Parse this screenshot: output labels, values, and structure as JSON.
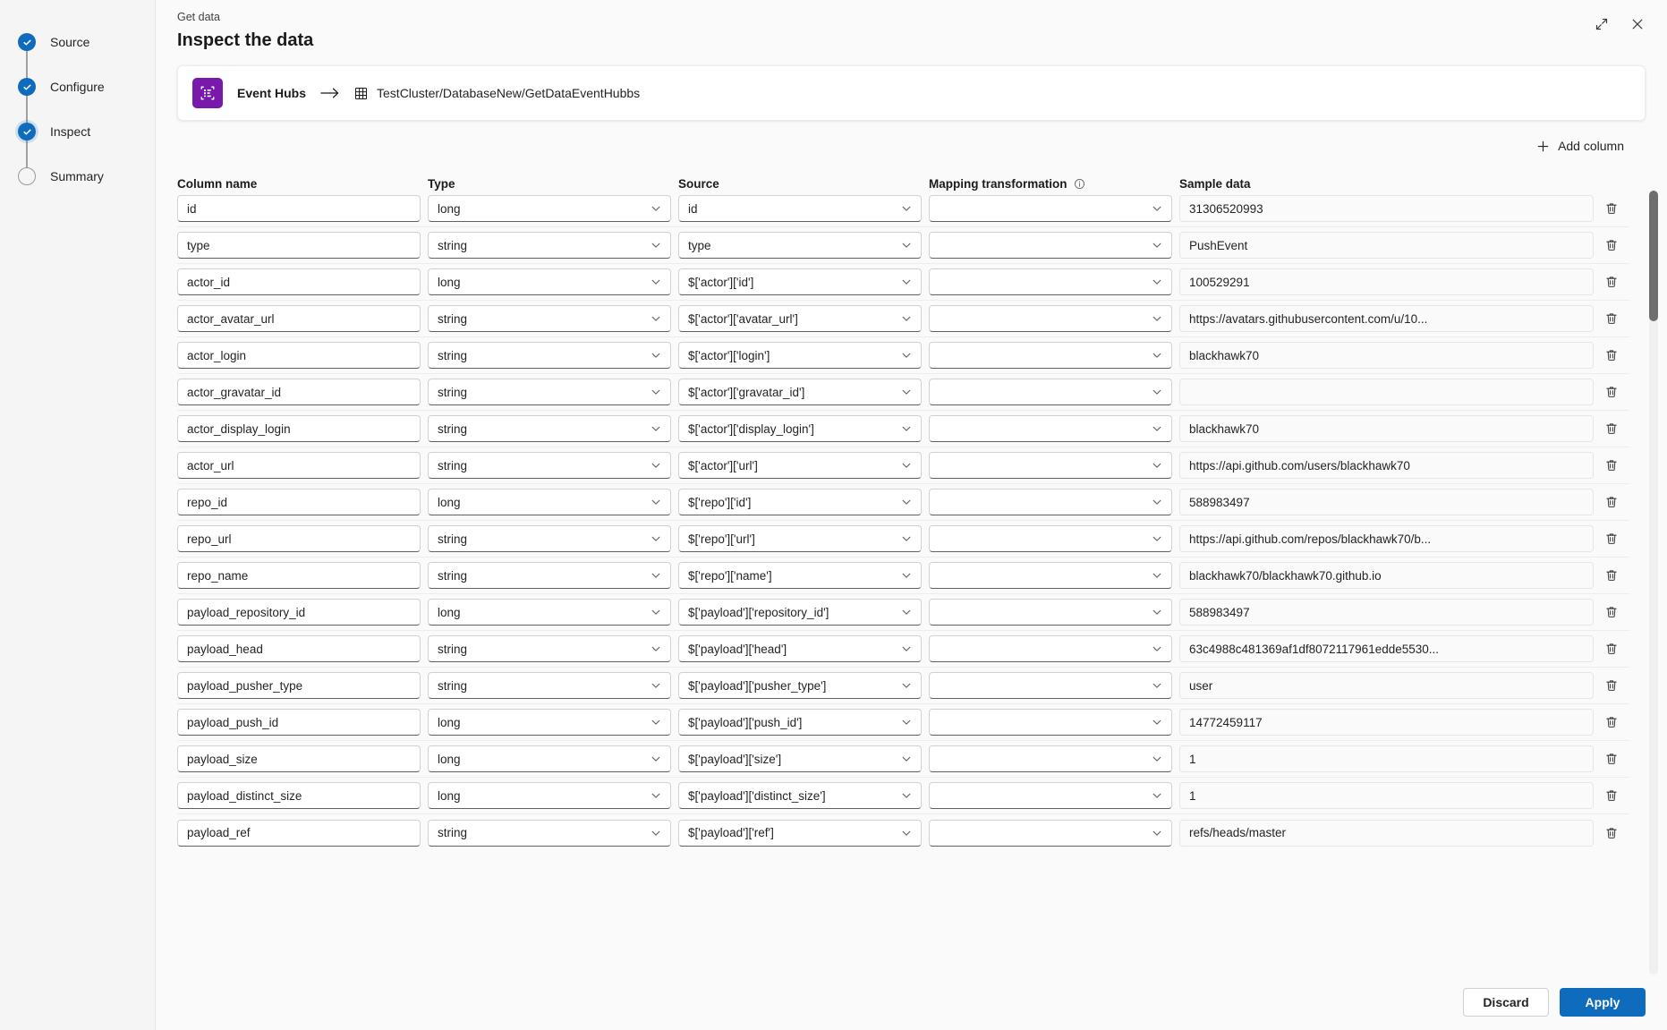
{
  "wizard": {
    "steps": [
      {
        "label": "Source",
        "state": "done"
      },
      {
        "label": "Configure",
        "state": "done"
      },
      {
        "label": "Inspect",
        "state": "current"
      },
      {
        "label": "Summary",
        "state": "todo"
      }
    ]
  },
  "header": {
    "eyebrow": "Get data",
    "title": "Inspect the data",
    "expand_icon": "expand-icon",
    "close_icon": "close-icon"
  },
  "source_card": {
    "icon": "event-hubs-icon",
    "source_label": "Event Hubs",
    "arrow_icon": "arrow-right-icon",
    "table_icon": "table-icon",
    "destination_label": "TestCluster/DatabaseNew/GetDataEventHubbs"
  },
  "toolbar": {
    "add_column_label": "Add column",
    "add_icon": "plus-icon"
  },
  "grid": {
    "headers": {
      "column_name": "Column name",
      "type": "Type",
      "source": "Source",
      "mapping_transformation": "Mapping transformation",
      "mapping_info_icon": "info-icon",
      "sample_data": "Sample data"
    },
    "delete_icon": "trash-icon",
    "chevron_icon": "chevron-down-icon",
    "rows": [
      {
        "column_name": "id",
        "type": "long",
        "source": "id",
        "mapping": "",
        "sample": "31306520993"
      },
      {
        "column_name": "type",
        "type": "string",
        "source": "type",
        "mapping": "",
        "sample": "PushEvent"
      },
      {
        "column_name": "actor_id",
        "type": "long",
        "source": "$['actor']['id']",
        "mapping": "",
        "sample": "100529291"
      },
      {
        "column_name": "actor_avatar_url",
        "type": "string",
        "source": "$['actor']['avatar_url']",
        "mapping": "",
        "sample": "https://avatars.githubusercontent.com/u/10..."
      },
      {
        "column_name": "actor_login",
        "type": "string",
        "source": "$['actor']['login']",
        "mapping": "",
        "sample": "blackhawk70"
      },
      {
        "column_name": "actor_gravatar_id",
        "type": "string",
        "source": "$['actor']['gravatar_id']",
        "mapping": "",
        "sample": ""
      },
      {
        "column_name": "actor_display_login",
        "type": "string",
        "source": "$['actor']['display_login']",
        "mapping": "",
        "sample": "blackhawk70"
      },
      {
        "column_name": "actor_url",
        "type": "string",
        "source": "$['actor']['url']",
        "mapping": "",
        "sample": "https://api.github.com/users/blackhawk70"
      },
      {
        "column_name": "repo_id",
        "type": "long",
        "source": "$['repo']['id']",
        "mapping": "",
        "sample": "588983497"
      },
      {
        "column_name": "repo_url",
        "type": "string",
        "source": "$['repo']['url']",
        "mapping": "",
        "sample": "https://api.github.com/repos/blackhawk70/b..."
      },
      {
        "column_name": "repo_name",
        "type": "string",
        "source": "$['repo']['name']",
        "mapping": "",
        "sample": "blackhawk70/blackhawk70.github.io"
      },
      {
        "column_name": "payload_repository_id",
        "type": "long",
        "source": "$['payload']['repository_id']",
        "mapping": "",
        "sample": "588983497"
      },
      {
        "column_name": "payload_head",
        "type": "string",
        "source": "$['payload']['head']",
        "mapping": "",
        "sample": "63c4988c481369af1df8072117961edde5530..."
      },
      {
        "column_name": "payload_pusher_type",
        "type": "string",
        "source": "$['payload']['pusher_type']",
        "mapping": "",
        "sample": "user"
      },
      {
        "column_name": "payload_push_id",
        "type": "long",
        "source": "$['payload']['push_id']",
        "mapping": "",
        "sample": "14772459117"
      },
      {
        "column_name": "payload_size",
        "type": "long",
        "source": "$['payload']['size']",
        "mapping": "",
        "sample": "1"
      },
      {
        "column_name": "payload_distinct_size",
        "type": "long",
        "source": "$['payload']['distinct_size']",
        "mapping": "",
        "sample": "1"
      },
      {
        "column_name": "payload_ref",
        "type": "string",
        "source": "$['payload']['ref']",
        "mapping": "",
        "sample": "refs/heads/master"
      }
    ]
  },
  "footer": {
    "discard_label": "Discard",
    "apply_label": "Apply"
  },
  "colors": {
    "accent": "#0f6cbd",
    "event_hubs_purple": "#7719aa",
    "panel_bg": "#fafafa",
    "sidebar_bg": "#f5f5f5"
  }
}
